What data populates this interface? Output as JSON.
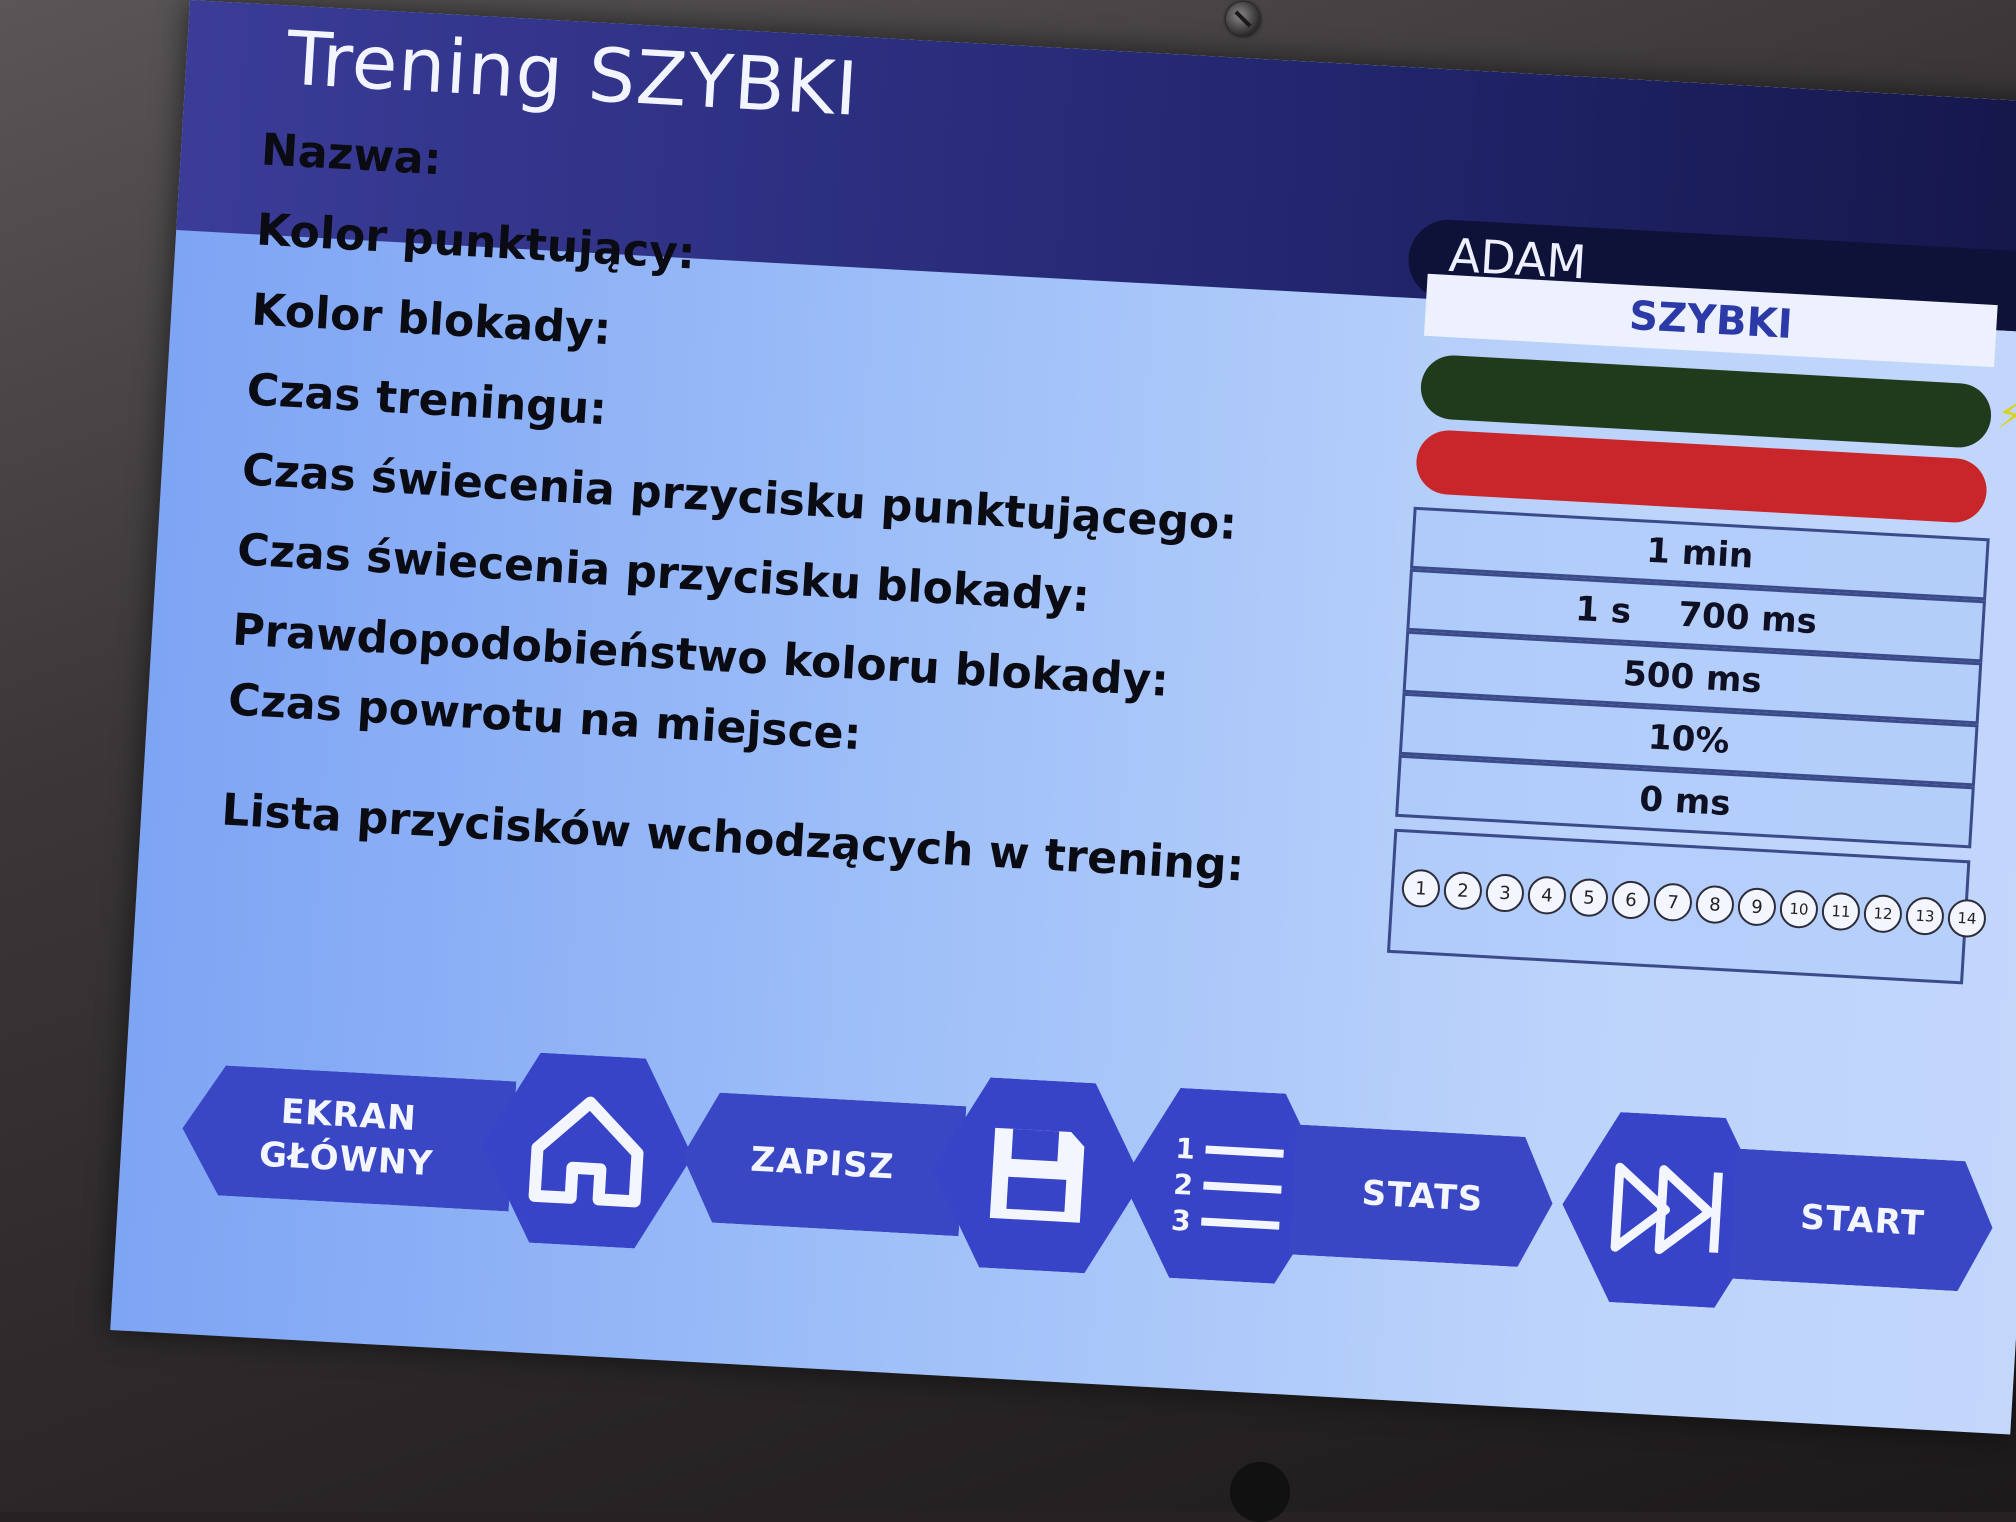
{
  "header": {
    "title": "Trening SZYBKI",
    "name_value": "ADAM"
  },
  "settings": {
    "rows": [
      {
        "label": "Nazwa:"
      },
      {
        "label": "Kolor punktujący:"
      },
      {
        "label": "Kolor blokady:"
      },
      {
        "label": "Czas treningu:"
      },
      {
        "label": "Czas świecenia przycisku punktującego:"
      },
      {
        "label": "Czas świecenia przycisku blokady:"
      },
      {
        "label": "Prawdopodobieństwo koloru blokady:"
      },
      {
        "label": "Czas powrotu na miejsce:"
      },
      {
        "label": "Lista przycisków wchodzących w trening:"
      }
    ],
    "mode_value": "SZYBKI",
    "scoring_color": "#1f3b1c",
    "block_color": "#c8262a",
    "training_time": "1 min",
    "scoring_light_time": "1 s    700 ms",
    "block_light_time": "500 ms",
    "block_probability": "10%",
    "return_time": "0 ms",
    "button_list": [
      "1",
      "2",
      "3",
      "4",
      "5",
      "6",
      "7",
      "8",
      "9",
      "10",
      "11",
      "12",
      "13",
      "14"
    ]
  },
  "nav": {
    "home_label_1": "EKRAN",
    "home_label_2": "GŁÓWNY",
    "save_label": "ZAPISZ",
    "stats_label": "STATS",
    "start_label": "START"
  },
  "icons": {
    "home": "home-icon",
    "save": "floppy-disk-icon",
    "stats": "numbered-list-icon",
    "start": "fast-forward-icon",
    "bolt": "lightning-icon"
  }
}
